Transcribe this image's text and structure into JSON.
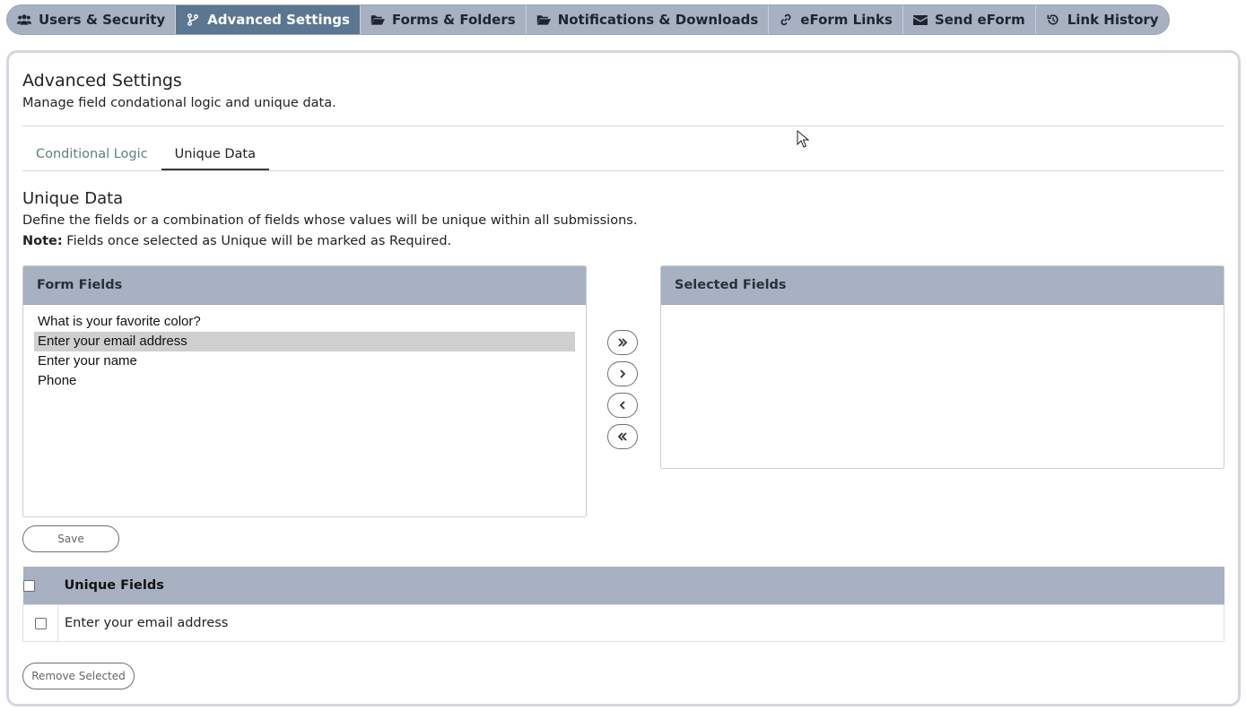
{
  "nav": {
    "items": [
      {
        "label": "Users & Security",
        "icon": "users-icon",
        "active": false
      },
      {
        "label": "Advanced Settings",
        "icon": "branch-icon",
        "active": true
      },
      {
        "label": "Forms & Folders",
        "icon": "folder-open-icon",
        "active": false
      },
      {
        "label": "Notifications & Downloads",
        "icon": "folder-open-icon",
        "active": false
      },
      {
        "label": "eForm Links",
        "icon": "link-icon",
        "active": false
      },
      {
        "label": "Send eForm",
        "icon": "envelope-icon",
        "active": false
      },
      {
        "label": "Link History",
        "icon": "history-icon",
        "active": false
      }
    ]
  },
  "page": {
    "title": "Advanced Settings",
    "subtitle": "Manage field condational logic and unique data."
  },
  "tabs": [
    {
      "label": "Conditional Logic",
      "active": false
    },
    {
      "label": "Unique Data",
      "active": true
    }
  ],
  "unique": {
    "title": "Unique Data",
    "description": "Define the fields or a combination of fields whose values will be unique within all submissions.",
    "note_label": "Note:",
    "note_text": " Fields once selected as Unique will be marked as Required.",
    "form_fields_header": "Form Fields",
    "selected_fields_header": "Selected Fields",
    "form_fields": [
      "What is your favorite color?",
      "Enter your email address",
      "Enter your name",
      "Phone"
    ],
    "selected_form_field_index": 1,
    "selected_fields": [],
    "move_buttons": [
      "move-all-right",
      "move-right",
      "move-left",
      "move-all-left"
    ],
    "save_label": "Save",
    "table_header": "Unique Fields",
    "table_rows": [
      "Enter your email address"
    ],
    "remove_label": "Remove Selected"
  },
  "colors": {
    "nav_bg": "#a7b1c2",
    "nav_active": "#5b7690",
    "tab_inactive": "#5e8181",
    "list_selected": "#cfcfcf"
  }
}
